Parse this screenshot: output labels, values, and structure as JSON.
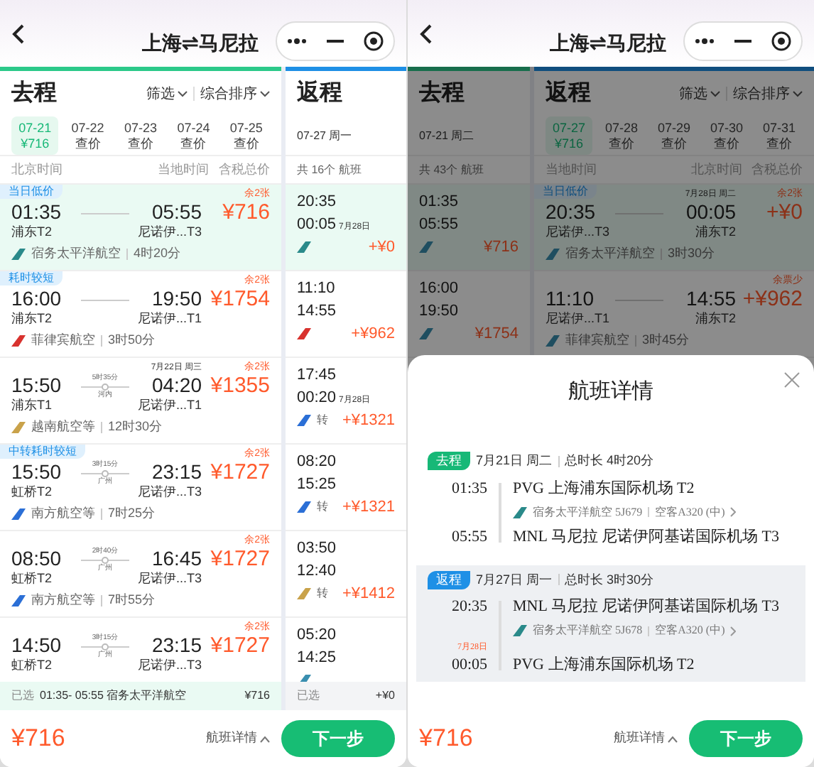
{
  "left": {
    "header": {
      "title": "上海⇌马尼拉"
    },
    "outbound": {
      "title": "去程",
      "filter": "筛选",
      "sort": "综合排序",
      "dates": [
        {
          "date": "07-21",
          "price": "¥716",
          "selected": true
        },
        {
          "date": "07-22",
          "price": "查价",
          "selected": false
        },
        {
          "date": "07-23",
          "price": "查价",
          "selected": false
        },
        {
          "date": "07-24",
          "price": "查价",
          "selected": false
        },
        {
          "date": "07-25",
          "price": "查价",
          "selected": false
        }
      ],
      "columns": [
        "北京时间",
        "当地时间",
        "含税总价"
      ],
      "flights": [
        {
          "tag": "当日低价",
          "dep": "01:35",
          "dep_airport": "浦东T2",
          "arr": "05:55",
          "arr_airport": "尼诺伊...T3",
          "remaining": "余2张",
          "price": "¥716",
          "color": "#2a8a8a",
          "airline": "宿务太平洋航空",
          "duration": "4时20分",
          "selected": true
        },
        {
          "tag": "耗时较短",
          "dep": "16:00",
          "dep_airport": "浦东T2",
          "arr": "19:50",
          "arr_airport": "尼诺伊...T1",
          "remaining": "余2张",
          "price": "¥1754",
          "color": "#d8322e",
          "airline": "菲律宾航空",
          "duration": "3时50分",
          "selected": false
        },
        {
          "dep": "15:50",
          "dep_airport": "浦东T1",
          "arr": "04:20",
          "arr_date": "7月22日 周三",
          "arr_airport": "尼诺伊...T1",
          "stopover": {
            "duration": "5时35分",
            "city": "河内"
          },
          "remaining": "余2张",
          "price": "¥1355",
          "color": "#c9a24a",
          "airline": "越南航空等",
          "duration": "12时30分",
          "selected": false
        },
        {
          "tag": "中转耗时较短",
          "dep": "15:50",
          "dep_airport": "虹桥T2",
          "arr": "23:15",
          "arr_airport": "尼诺伊...T3",
          "stopover": {
            "duration": "3时15分",
            "city": "广州"
          },
          "remaining": "余2张",
          "price": "¥1727",
          "color": "#2b6fd6",
          "airline": "南方航空等",
          "duration": "7时25分",
          "selected": false
        },
        {
          "dep": "08:50",
          "dep_airport": "虹桥T2",
          "arr": "16:45",
          "arr_airport": "尼诺伊...T3",
          "stopover": {
            "duration": "2时40分",
            "city": "广州"
          },
          "remaining": "余2张",
          "price": "¥1727",
          "color": "#2b6fd6",
          "airline": "南方航空等",
          "duration": "7时55分",
          "selected": false
        },
        {
          "dep": "14:50",
          "dep_airport": "虹桥T2",
          "arr": "23:15",
          "arr_airport": "尼诺伊...T3",
          "stopover": {
            "duration": "3时15分",
            "city": "广州"
          },
          "remaining": "余2张",
          "price": "¥1727",
          "selected": false
        }
      ],
      "selected_bar": {
        "label": "已选",
        "flight": "01:35- 05:55 宿务太平洋航空",
        "price": "¥716"
      }
    },
    "return": {
      "title": "返程",
      "date": "07-27 周一",
      "count": "共 16个 航班",
      "flights": [
        {
          "dep": "20:35",
          "arr": "00:05",
          "arr_date": "7月28日",
          "color": "#2a8a8a",
          "price": "+¥0",
          "selected": true
        },
        {
          "dep": "11:10",
          "arr": "14:55",
          "color": "#d8322e",
          "price": "+¥962",
          "selected": false
        },
        {
          "dep": "17:45",
          "arr": "00:20",
          "arr_date": "7月28日",
          "color": "#2b6fd6",
          "transfer": "转",
          "price": "+¥1321",
          "selected": false
        },
        {
          "dep": "08:20",
          "arr": "15:25",
          "color": "#2b6fd6",
          "transfer": "转",
          "price": "+¥1321",
          "selected": false
        },
        {
          "dep": "03:50",
          "arr": "12:40",
          "color": "#c9a24a",
          "transfer": "转",
          "price": "+¥1412",
          "selected": false
        },
        {
          "dep": "05:20",
          "arr": "14:25",
          "selected": false
        }
      ],
      "selected_bar": {
        "label": "已选",
        "price": "+¥0"
      }
    },
    "footer": {
      "price": "¥716",
      "details": "航班详情",
      "next": "下一步"
    }
  },
  "right": {
    "header": {
      "title": "上海⇌马尼拉"
    },
    "outbound": {
      "title": "去程",
      "date": "07-21 周二",
      "count": "共 43个 航班",
      "flights": [
        {
          "dep": "01:35",
          "arr": "05:55",
          "price": "¥716",
          "selected": true
        },
        {
          "dep": "16:00",
          "arr": "19:50",
          "price": "¥1754",
          "selected": false
        }
      ]
    },
    "return": {
      "title": "返程",
      "filter": "筛选",
      "sort": "综合排序",
      "dates": [
        {
          "date": "07-27",
          "price": "¥716",
          "selected": true
        },
        {
          "date": "07-28",
          "price": "查价",
          "selected": false
        },
        {
          "date": "07-29",
          "price": "查价",
          "selected": false
        },
        {
          "date": "07-30",
          "price": "查价",
          "selected": false
        },
        {
          "date": "07-31",
          "price": "查价",
          "selected": false
        }
      ],
      "columns": [
        "当地时间",
        "北京时间",
        "含税总价"
      ],
      "flights": [
        {
          "tag": "当日低价",
          "dep": "20:35",
          "dep_airport": "尼诺伊...T3",
          "arr": "00:05",
          "arr_date": "7月28日 周二",
          "arr_airport": "浦东T2",
          "remaining": "余2张",
          "price": "+¥0",
          "airline": "宿务太平洋航空",
          "duration": "3时30分",
          "selected": true
        },
        {
          "dep": "11:10",
          "dep_airport": "尼诺伊...T1",
          "arr": "14:55",
          "arr_airport": "浦东T2",
          "remaining": "余票少",
          "price": "+¥962",
          "airline": "菲律宾航空",
          "duration": "3时45分",
          "selected": false
        }
      ]
    },
    "sheet": {
      "title": "航班详情",
      "segments": [
        {
          "badge": "去程",
          "color": "#17b877",
          "date": "7月21日 周二",
          "total": "总时长 4时20分",
          "dep_time": "01:35",
          "dep_airport": "PVG 上海浦东国际机场 T2",
          "flight": "宿务太平洋航空 5J679",
          "aircraft": "空客A320 (中)",
          "arr_time": "05:55",
          "arr_airport": "MNL 马尼拉 尼诺伊阿基诺国际机场 T3",
          "highlighted": false
        },
        {
          "badge": "返程",
          "color": "#1e90e6",
          "date": "7月27日 周一",
          "total": "总时长 3时30分",
          "dep_time": "20:35",
          "dep_airport": "MNL 马尼拉 尼诺伊阿基诺国际机场 T3",
          "flight": "宿务太平洋航空 5J678",
          "aircraft": "空客A320 (中)",
          "arr_date": "7月28日",
          "arr_time": "00:05",
          "arr_airport": "PVG 上海浦东国际机场 T2",
          "highlighted": true
        }
      ]
    },
    "footer": {
      "price": "¥716",
      "details": "航班详情",
      "next": "下一步"
    }
  }
}
